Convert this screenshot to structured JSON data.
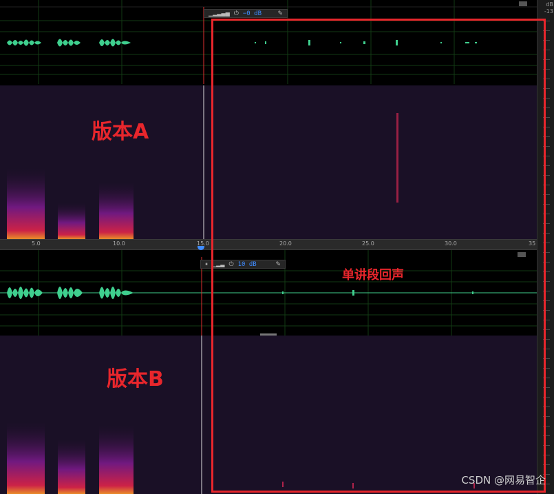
{
  "version_a": {
    "label": "版本A",
    "hud": {
      "level_value": "−0 dB"
    }
  },
  "version_b": {
    "label": "版本B",
    "hud": {
      "level_value": "10 dB"
    }
  },
  "annotation": {
    "echo_label": "单讲段回声"
  },
  "ruler": {
    "ticks": [
      "5.0",
      "10.0",
      "15.0",
      "20.0",
      "25.0",
      "30.0",
      "35"
    ]
  },
  "sidebar": {
    "top_label": "dB",
    "top_value": "-13"
  },
  "watermark": {
    "text": "CSDN @网易智企"
  },
  "colors": {
    "waveform": "#3fcf8e",
    "spectrogram_bg": "#1a1026",
    "highlight_box": "#e8262c",
    "playhead": "#e03030",
    "hud_db": "#3f8cff"
  }
}
